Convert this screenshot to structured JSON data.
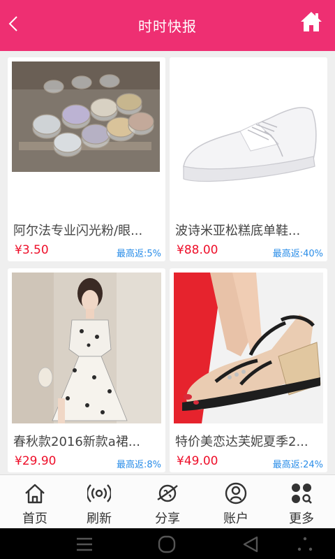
{
  "header": {
    "title": "时时快报"
  },
  "products": [
    {
      "name": "阿尔法专业闪光粉/眼...",
      "price": "¥3.50",
      "rebate": "最高返:5%"
    },
    {
      "name": "波诗米亚松糕底单鞋...",
      "price": "¥88.00",
      "rebate": "最高返:40%"
    },
    {
      "name": "春秋款2016新款a裙...",
      "price": "¥29.90",
      "rebate": "最高返:8%"
    },
    {
      "name": "特价美恋达芙妮夏季2...",
      "price": "¥49.00",
      "rebate": "最高返:24%"
    }
  ],
  "tabs": [
    {
      "label": "首页",
      "icon": "home-icon"
    },
    {
      "label": "刷新",
      "icon": "broadcast-icon"
    },
    {
      "label": "分享",
      "icon": "planet-icon"
    },
    {
      "label": "账户",
      "icon": "user-icon"
    },
    {
      "label": "更多",
      "icon": "more-grid-icon"
    }
  ],
  "colors": {
    "header": "#ee2f72",
    "price": "#ee0f2a",
    "rebate": "#2a8de8"
  }
}
